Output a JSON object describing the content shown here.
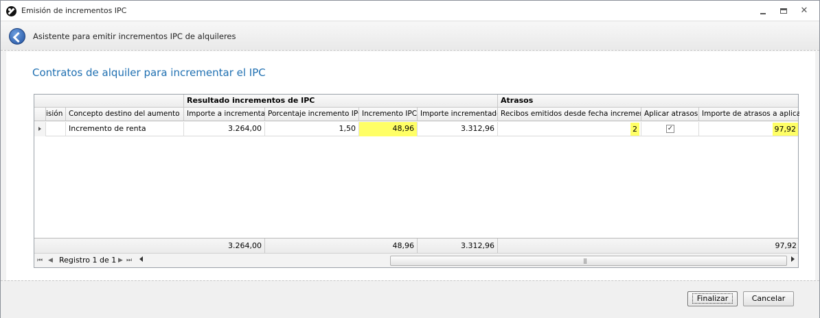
{
  "window": {
    "title": "Emisión de incrementos IPC",
    "close_glyph": "✕"
  },
  "wizard": {
    "title": "Asistente para emitir incrementos IPC de alquileres"
  },
  "page": {
    "heading": "Contratos de alquiler para incrementar el IPC"
  },
  "grid": {
    "bands": [
      "Resultado incrementos de IPC",
      "Atrasos"
    ],
    "columns": [
      "isión",
      "Concepto destino del aumento",
      "Importe a incrementar",
      "Porcentaje incremento IPC",
      "Incremento IPC",
      "Importe incrementado",
      "Recibos emitidos desde fecha incremento",
      "Aplicar atrasos",
      "Importe de atrasos a aplicar"
    ],
    "rows": [
      {
        "emision": "",
        "concepto": "Incremento de renta",
        "importe": "3.264,00",
        "porcentaje": "1,50",
        "incremento": "48,96",
        "incrementado": "3.312,96",
        "recibos": "2",
        "aplicar_atrasos": true,
        "check_glyph": "✓",
        "atrasos": "97,92"
      }
    ],
    "totals": {
      "importe": "3.264,00",
      "incremento": "48,96",
      "incrementado": "3.312,96",
      "atrasos": "97,92"
    },
    "navigator": {
      "record_label": "Registro 1 de 1",
      "first": "⏮",
      "prev": "◀",
      "next": "▶",
      "last": "⏭",
      "grip": "|||"
    },
    "highlight_color": "#ffff66"
  },
  "buttons": {
    "finish": "Finalizar",
    "cancel": "Cancelar"
  },
  "colors": {
    "heading": "#1e6fb1",
    "highlight": "#ffff66"
  }
}
